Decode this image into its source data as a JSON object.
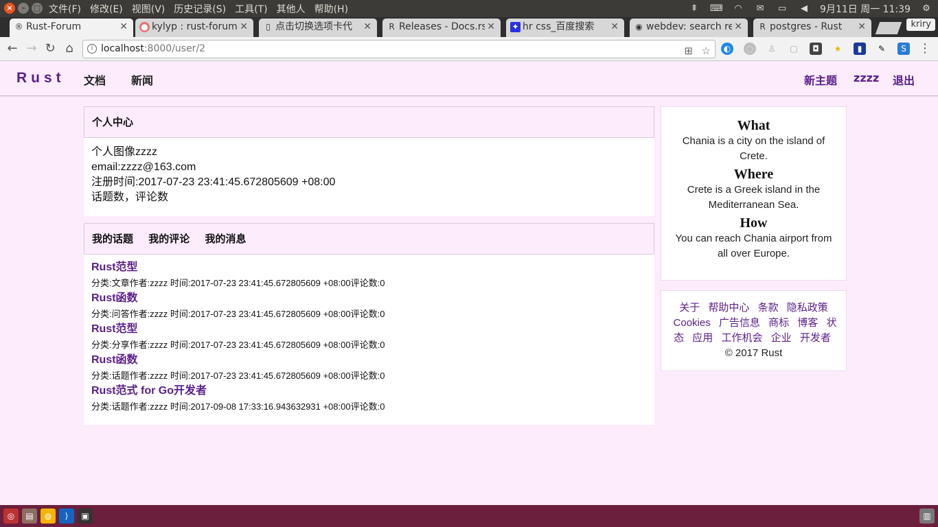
{
  "os": {
    "menus": [
      "文件(F)",
      "修改(E)",
      "视图(V)",
      "历史记录(S)",
      "工具(T)",
      "其他人",
      "帮助(H)"
    ],
    "clock": "9月11日 周一 11:39"
  },
  "tabs": [
    {
      "title": "Rust-Forum",
      "icon": "rust-logo-icon"
    },
    {
      "title": "kylyp : rust-forum",
      "icon": "github-icon"
    },
    {
      "title": "点击切换选项卡代",
      "icon": "page-icon"
    },
    {
      "title": "Releases - Docs.rs",
      "icon": "rust-logo-icon"
    },
    {
      "title": "hr css_百度搜索",
      "icon": "baidu-icon"
    },
    {
      "title": "webdev: search re",
      "icon": "reddit-icon"
    },
    {
      "title": "postgres - Rust",
      "icon": "rust-logo-icon"
    }
  ],
  "profile_name": "kriry",
  "address": {
    "host": "localhost",
    "path": ":8000/user/2"
  },
  "site": {
    "brand": "Rust",
    "nav_left": [
      "文档",
      "新闻"
    ],
    "nav_right": [
      "新主题",
      "zzzz",
      "退出"
    ]
  },
  "profile_panel": {
    "title": "个人中心",
    "lines": [
      "个人图像zzzz",
      "email:zzzz@163.com",
      "注册时间:2017-07-23 23:41:45.672805609 +08:00",
      "话题数，评论数"
    ]
  },
  "activity_panel": {
    "tabs": [
      "我的话题",
      "我的评论",
      "我的消息"
    ],
    "topics": [
      {
        "title": "Rust范型",
        "meta": "分类:文章作者:zzzz 时间:2017-07-23 23:41:45.672805609 +08:00评论数:0"
      },
      {
        "title": "Rust函数",
        "meta": "分类:问答作者:zzzz 时间:2017-07-23 23:41:45.672805609 +08:00评论数:0"
      },
      {
        "title": "Rust范型",
        "meta": "分类:分享作者:zzzz 时间:2017-07-23 23:41:45.672805609 +08:00评论数:0"
      },
      {
        "title": "Rust函数",
        "meta": "分类:话题作者:zzzz 时间:2017-07-23 23:41:45.672805609 +08:00评论数:0"
      },
      {
        "title": "Rust范式 for Go开发者",
        "meta": "分类:话题作者:zzzz 时间:2017-09-08 17:33:16.943632931 +08:00评论数:0"
      }
    ]
  },
  "sidebar": {
    "sections": [
      {
        "heading": "What",
        "text": "Chania is a city on the island of Crete."
      },
      {
        "heading": "Where",
        "text": "Crete is a Greek island in the Mediterranean Sea."
      },
      {
        "heading": "How",
        "text": "You can reach Chania airport from all over Europe."
      }
    ],
    "footer_links": [
      "关于",
      "帮助中心",
      "条款",
      "隐私政策",
      "Cookies",
      "广告信息",
      "商标",
      "博客",
      "状态",
      "应用",
      "工作机会",
      "企业",
      "开发者"
    ],
    "copyright": "© 2017 Rust"
  },
  "colors": {
    "accent": "#5a1e8a",
    "page_bg": "#fcecfc",
    "launcher": "#6b1f3c"
  }
}
